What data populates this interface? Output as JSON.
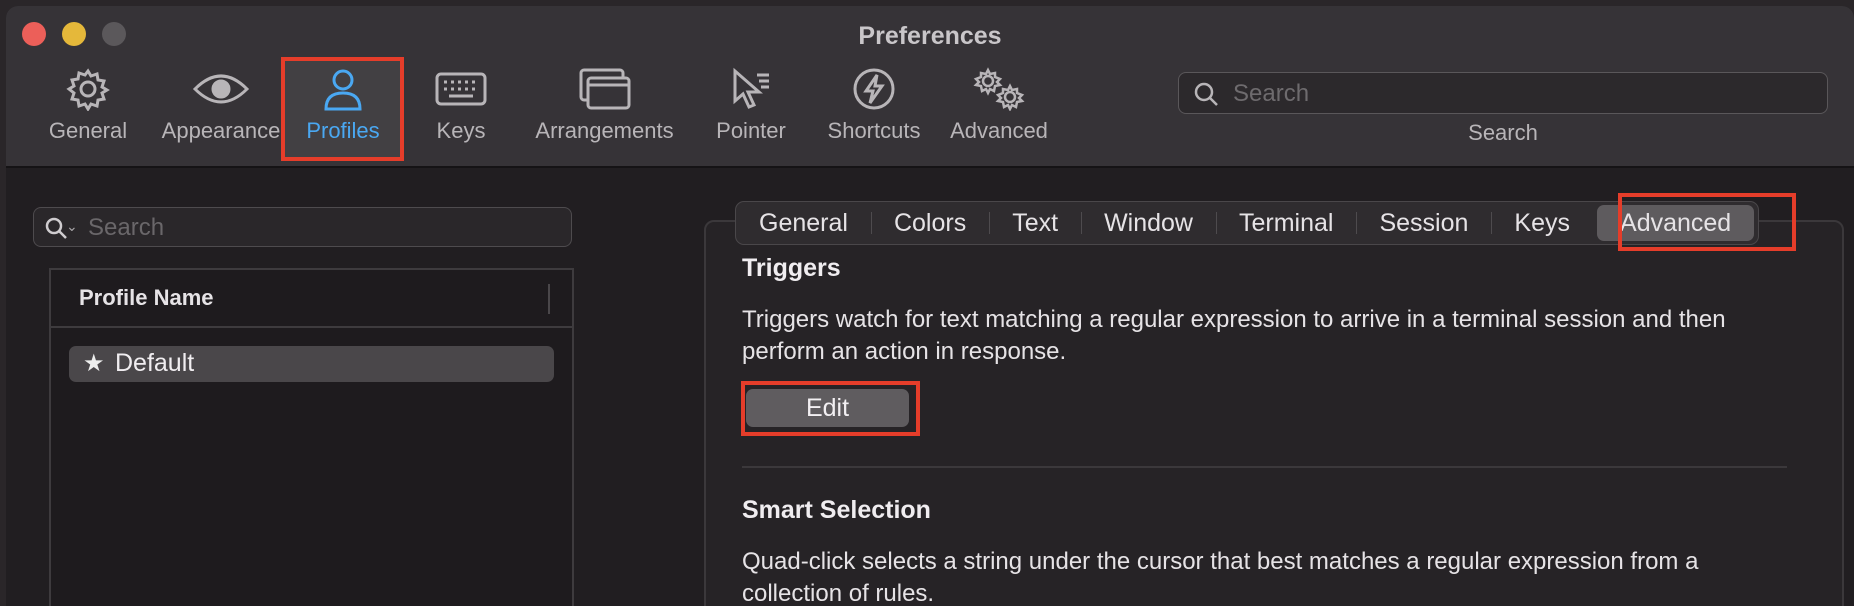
{
  "window": {
    "title": "Preferences"
  },
  "toolbar": {
    "items": [
      {
        "label": "General",
        "icon": "gear-icon"
      },
      {
        "label": "Appearance",
        "icon": "eye-icon"
      },
      {
        "label": "Profiles",
        "icon": "person-icon"
      },
      {
        "label": "Keys",
        "icon": "keyboard-icon"
      },
      {
        "label": "Arrangements",
        "icon": "windows-icon"
      },
      {
        "label": "Pointer",
        "icon": "pointer-icon"
      },
      {
        "label": "Shortcuts",
        "icon": "bolt-icon"
      },
      {
        "label": "Advanced",
        "icon": "gears-icon"
      }
    ],
    "selected": "Profiles",
    "search": {
      "placeholder": "Search",
      "caption": "Search"
    }
  },
  "profiles_pane": {
    "search_placeholder": "Search",
    "column_header": "Profile Name",
    "profiles": [
      {
        "name": "Default",
        "icon": "star-icon"
      }
    ]
  },
  "profile_tabs": {
    "tabs": [
      "General",
      "Colors",
      "Text",
      "Window",
      "Terminal",
      "Session",
      "Keys",
      "Advanced"
    ],
    "active": "Advanced"
  },
  "triggers": {
    "title": "Triggers",
    "description": "Triggers watch for text matching a regular expression to arrive in a terminal session and then perform an action in response.",
    "edit_label": "Edit"
  },
  "smart_selection": {
    "title": "Smart Selection",
    "description": "Quad-click selects a string under the cursor that best matches a regular expression from a collection of rules."
  },
  "colors": {
    "highlight": "#e53d2a",
    "selected_tool": "#4aa8f2"
  }
}
